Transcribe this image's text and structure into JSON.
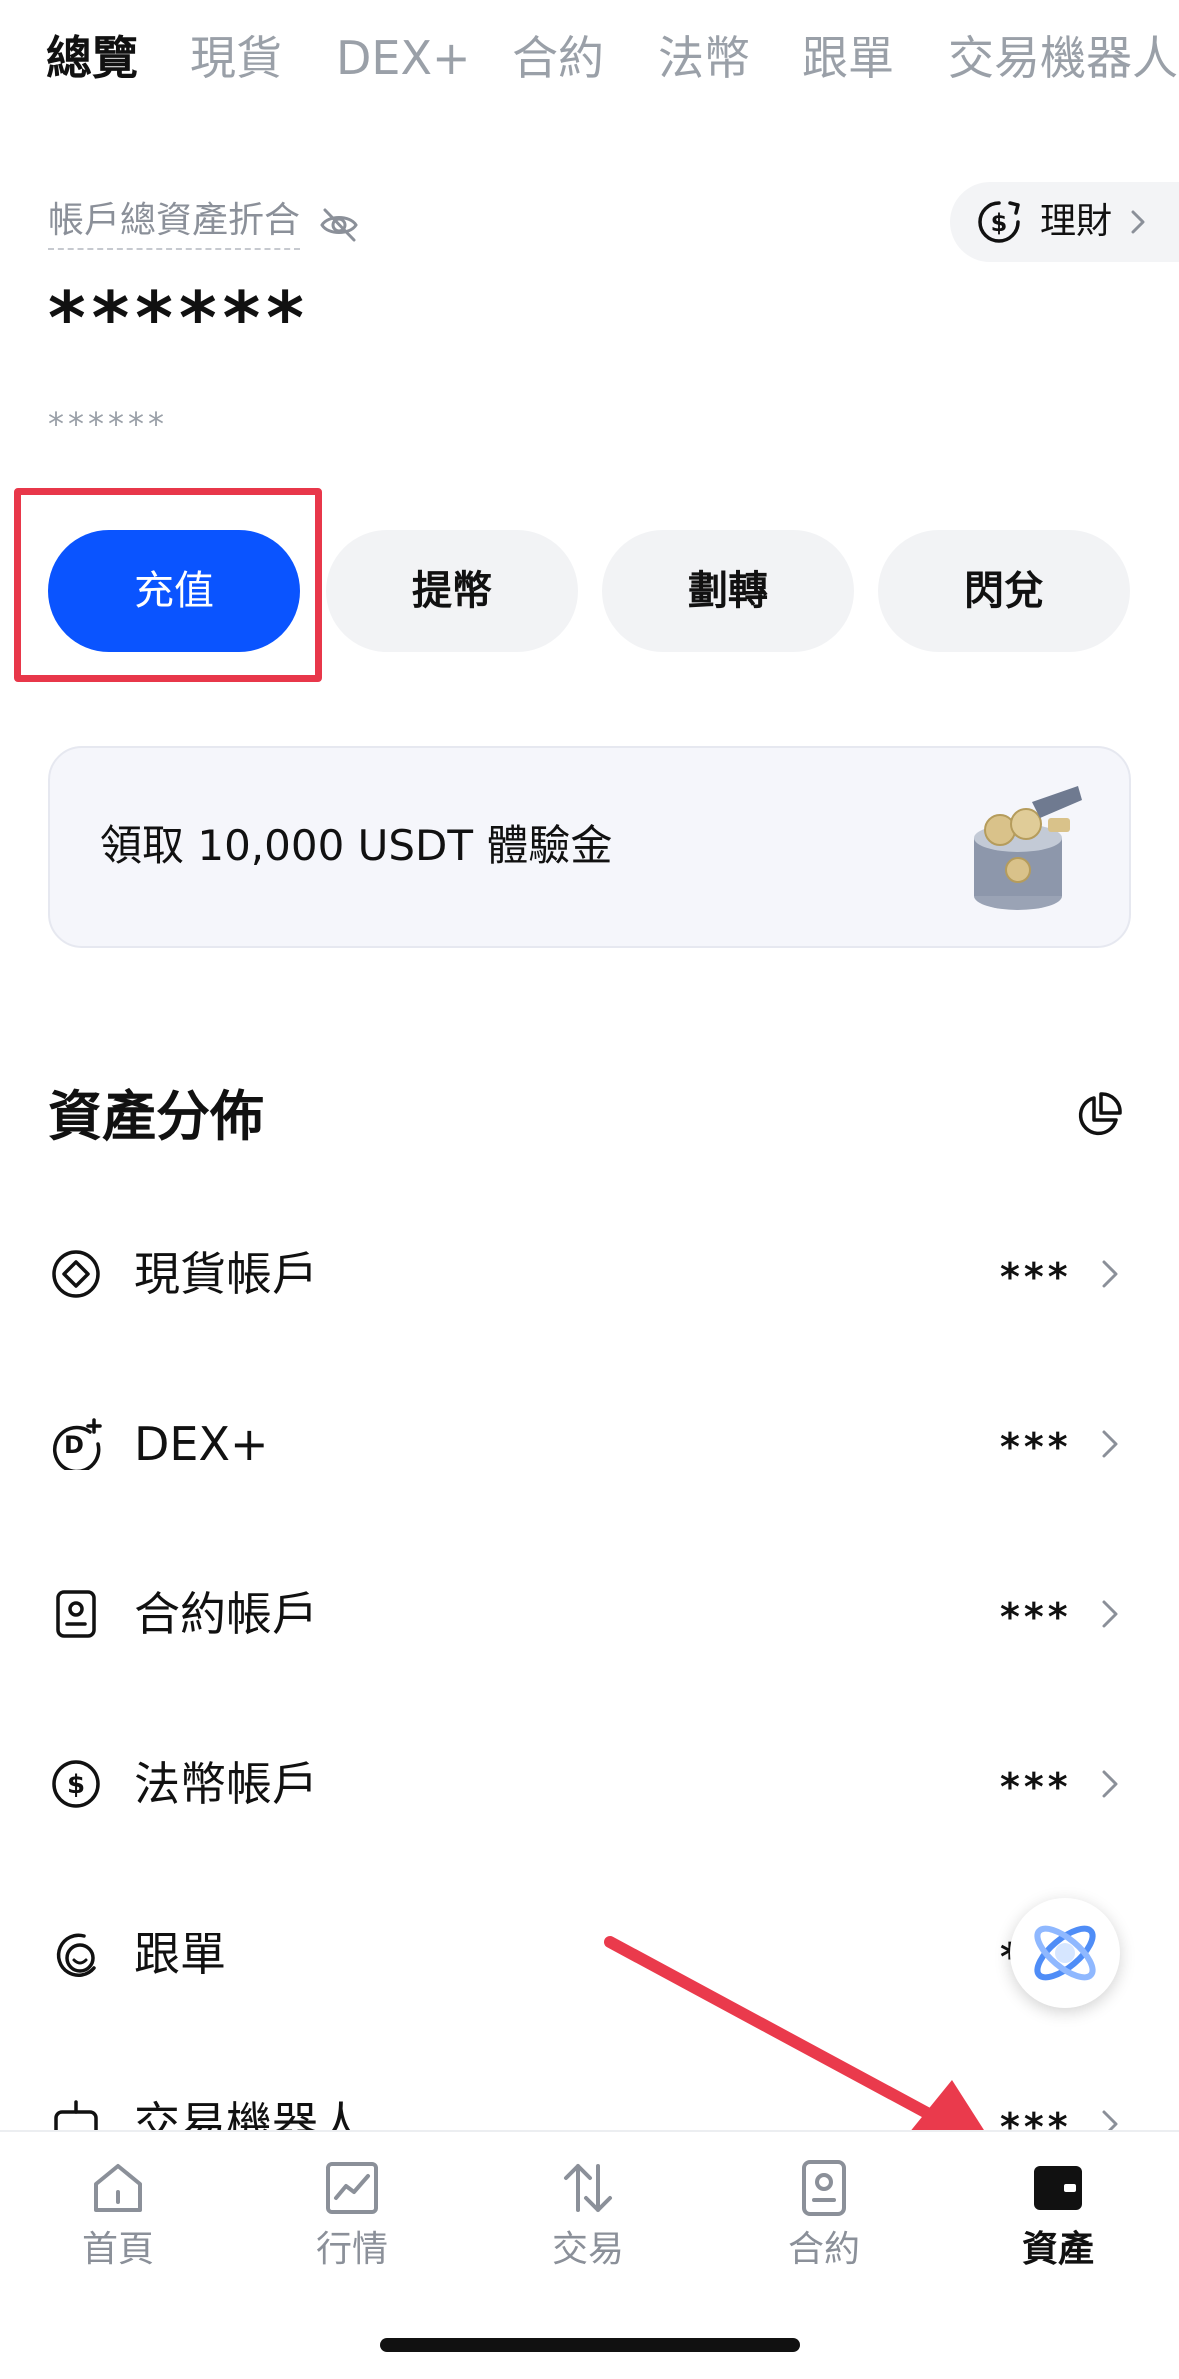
{
  "top_tabs": [
    {
      "label": "總覽",
      "active": true
    },
    {
      "label": "現貨",
      "active": false
    },
    {
      "label": "DEX+",
      "active": false
    },
    {
      "label": "合約",
      "active": false
    },
    {
      "label": "法幣",
      "active": false
    },
    {
      "label": "跟單",
      "active": false
    },
    {
      "label": "交易機器人",
      "active": false
    }
  ],
  "overview": {
    "total_label": "帳戶總資產折合",
    "total_value": "******",
    "sub_value": "******",
    "earn_label": "理財"
  },
  "actions": [
    {
      "label": "充值",
      "primary": true
    },
    {
      "label": "提幣",
      "primary": false
    },
    {
      "label": "劃轉",
      "primary": false
    },
    {
      "label": "閃兌",
      "primary": false
    }
  ],
  "promo": {
    "text": "領取 10,000 USDT 體驗金"
  },
  "distribution": {
    "title": "資產分佈",
    "accounts": [
      {
        "icon": "spot-diamond-icon",
        "label": "現貨帳戶",
        "value": "***"
      },
      {
        "icon": "dex-plus-icon",
        "label": "DEX+",
        "value": "***"
      },
      {
        "icon": "futures-doc-icon",
        "label": "合約帳戶",
        "value": "***"
      },
      {
        "icon": "dollar-circle-icon",
        "label": "法幣帳戶",
        "value": "***"
      },
      {
        "icon": "copy-trade-icon",
        "label": "跟單",
        "value": "***"
      },
      {
        "icon": "bot-icon",
        "label": "交易機器人",
        "value": "***"
      }
    ]
  },
  "bottom_nav": [
    {
      "label": "首頁",
      "icon": "home-icon",
      "active": false
    },
    {
      "label": "行情",
      "icon": "market-chart-icon",
      "active": false
    },
    {
      "label": "交易",
      "icon": "trade-arrows-icon",
      "active": false
    },
    {
      "label": "合約",
      "icon": "futures-icon",
      "active": false
    },
    {
      "label": "資產",
      "icon": "wallet-icon",
      "active": true
    }
  ],
  "colors": {
    "primary_blue": "#0a54ff",
    "highlight_red": "#e8374a",
    "muted_gray": "#8b9099"
  }
}
